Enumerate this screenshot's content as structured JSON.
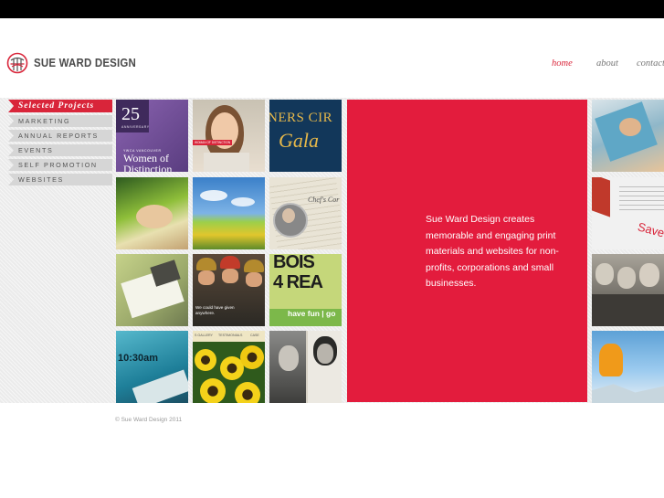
{
  "brand": {
    "name": "SUE WARD DESIGN",
    "accent": "#e31c3d"
  },
  "topnav": {
    "home": "home",
    "about": "about",
    "contact": "contact"
  },
  "sidebar": {
    "heading": "Selected Projects",
    "items": [
      "MARKETING",
      "ANNUAL REPORTS",
      "EVENTS",
      "SELF PROMOTION",
      "WEBSITES"
    ]
  },
  "tiles": {
    "women": {
      "big": "25",
      "sub": "ANNIVERSARY",
      "small": "YWCA VANCOUVER",
      "title": "Women of Distinction"
    },
    "girl_badge": "WOMAN OF DISTINCTION",
    "gala": {
      "top": "NERS CIR",
      "title": "Gala"
    },
    "chef": "Chef's Cor",
    "firefighters": "We could have given anywhere.",
    "bold": {
      "line1": "BOIS",
      "line2": "4 REA",
      "footer": "have fun | go"
    },
    "clock": "10:30am",
    "gallery": [
      "S GALLERY",
      "TESTIMONIALS",
      "CASE"
    ],
    "save": "Save"
  },
  "promo": {
    "text": "Sue Ward Design creates memorable and engaging print materials and websites for non-profits, corporations and small businesses."
  },
  "footer": {
    "copyright": "© Sue Ward Design 2011"
  },
  "icons": {
    "logo": "tree-in-circle-logo-icon"
  }
}
